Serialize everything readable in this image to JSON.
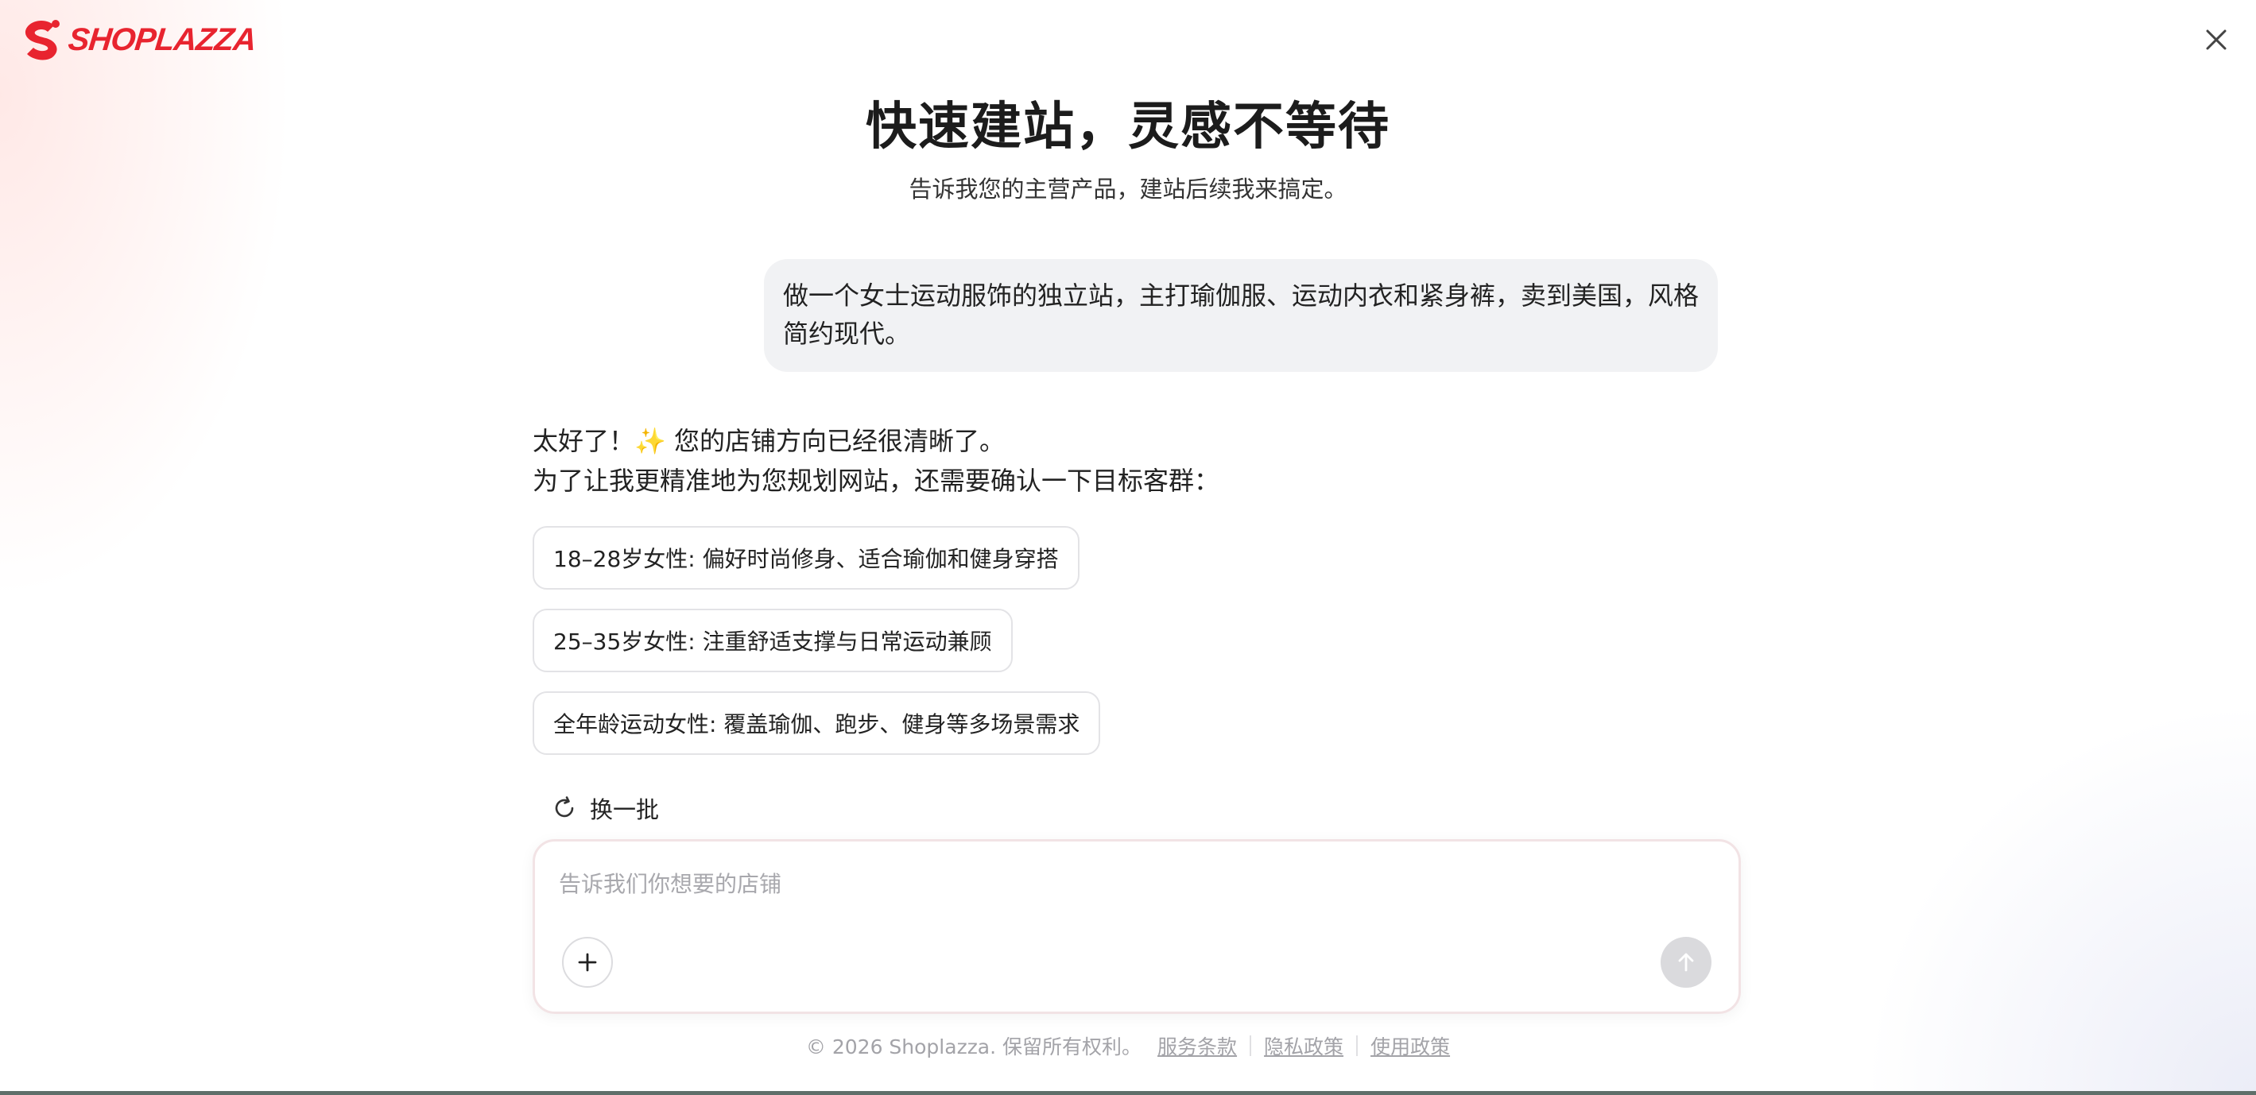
{
  "brand": {
    "name": "SHOPLAZZA",
    "color": "#e8242f"
  },
  "header": {
    "close_icon": "close-icon"
  },
  "hero": {
    "title": "快速建站，灵感不等待",
    "subtitle": "告诉我您的主营产品，建站后续我来搞定。"
  },
  "conversation": {
    "user_message": "做一个女士运动服饰的独立站，主打瑜伽服、运动内衣和紧身裤，卖到美国，风格简约现代。",
    "assistant_line1_prefix": "太好了！",
    "assistant_line1_emoji": "✨",
    "assistant_line1_suffix": " 您的店铺方向已经很清晰了。",
    "assistant_line2": "为了让我更精准地为您规划网站，还需要确认一下目标客群："
  },
  "options": [
    "18–28岁女性: 偏好时尚修身、适合瑜伽和健身穿搭",
    "25–35岁女性: 注重舒适支撑与日常运动兼顾",
    "全年龄运动女性: 覆盖瑜伽、跑步、健身等多场景需求"
  ],
  "refresh": {
    "label": "换一批",
    "icon": "refresh-icon"
  },
  "composer": {
    "placeholder": "告诉我们你想要的店铺",
    "value": "",
    "add_icon": "plus-icon",
    "send_icon": "arrow-up-icon"
  },
  "footer": {
    "copyright": "© 2026 Shoplazza. 保留所有权利。",
    "links": [
      "服务条款",
      "隐私政策",
      "使用政策"
    ]
  }
}
